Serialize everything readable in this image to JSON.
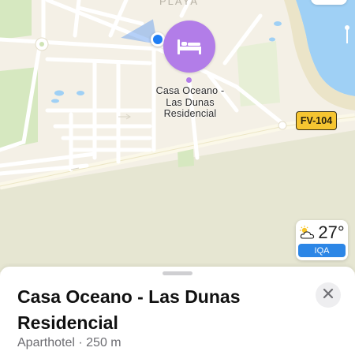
{
  "map": {
    "district_label": "PLAYA",
    "place_label_lines": [
      "Casa Oceano -",
      "Las Dunas",
      "Residencial"
    ],
    "pin_icon": "bed-icon",
    "route_shield": "FV-104",
    "colors": {
      "land": "#f4f0e6",
      "park": "#cfe3b5",
      "water": "#9fd0f5",
      "sand": "#e9e3c9",
      "road": "#ffffff",
      "pin": "#b27de8",
      "user_location": "#1f7ef5"
    }
  },
  "weather": {
    "icon": "partly-sunny-icon",
    "temperature": "27°",
    "aqi_label": "IQA",
    "aqi_color": "#2c86e6"
  },
  "sheet": {
    "title_lines": [
      "Casa Oceano - Las Dunas",
      "Residencial"
    ],
    "subtitle": "Aparthotel · 250 m",
    "close_icon": "close-icon"
  }
}
